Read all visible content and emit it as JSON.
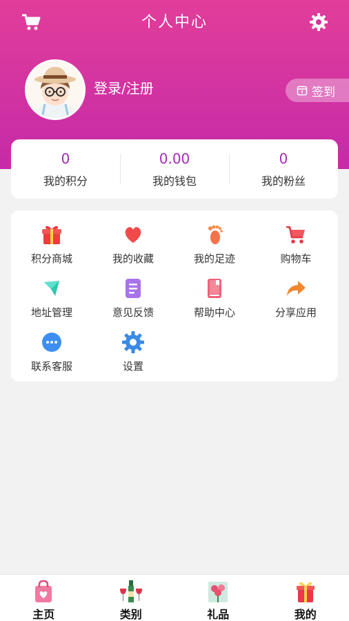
{
  "header": {
    "title": "个人中心",
    "login_label": "登录/注册",
    "signin_label": "签到"
  },
  "stats": [
    {
      "value": "0",
      "label": "我的积分"
    },
    {
      "value": "0.00",
      "label": "我的钱包"
    },
    {
      "value": "0",
      "label": "我的粉丝"
    }
  ],
  "menu": [
    {
      "label": "积分商城",
      "icon": "gift-icon"
    },
    {
      "label": "我的收藏",
      "icon": "heart-icon"
    },
    {
      "label": "我的足迹",
      "icon": "footprint-icon"
    },
    {
      "label": "购物车",
      "icon": "cart-icon"
    },
    {
      "label": "地址管理",
      "icon": "location-icon"
    },
    {
      "label": "意见反馈",
      "icon": "feedback-icon"
    },
    {
      "label": "帮助中心",
      "icon": "help-book-icon"
    },
    {
      "label": "分享应用",
      "icon": "share-icon"
    },
    {
      "label": "联系客服",
      "icon": "chat-icon"
    },
    {
      "label": "设置",
      "icon": "settings-icon"
    }
  ],
  "bottom_nav": [
    {
      "label": "主页",
      "icon": "shopping-bag-icon"
    },
    {
      "label": "类别",
      "icon": "wine-icon"
    },
    {
      "label": "礼品",
      "icon": "flower-icon"
    },
    {
      "label": "我的",
      "icon": "gift-box-icon"
    }
  ],
  "colors": {
    "header_top": "#e23d9a",
    "header_bottom": "#c52ba8",
    "stat_value": "#a22bb5"
  }
}
